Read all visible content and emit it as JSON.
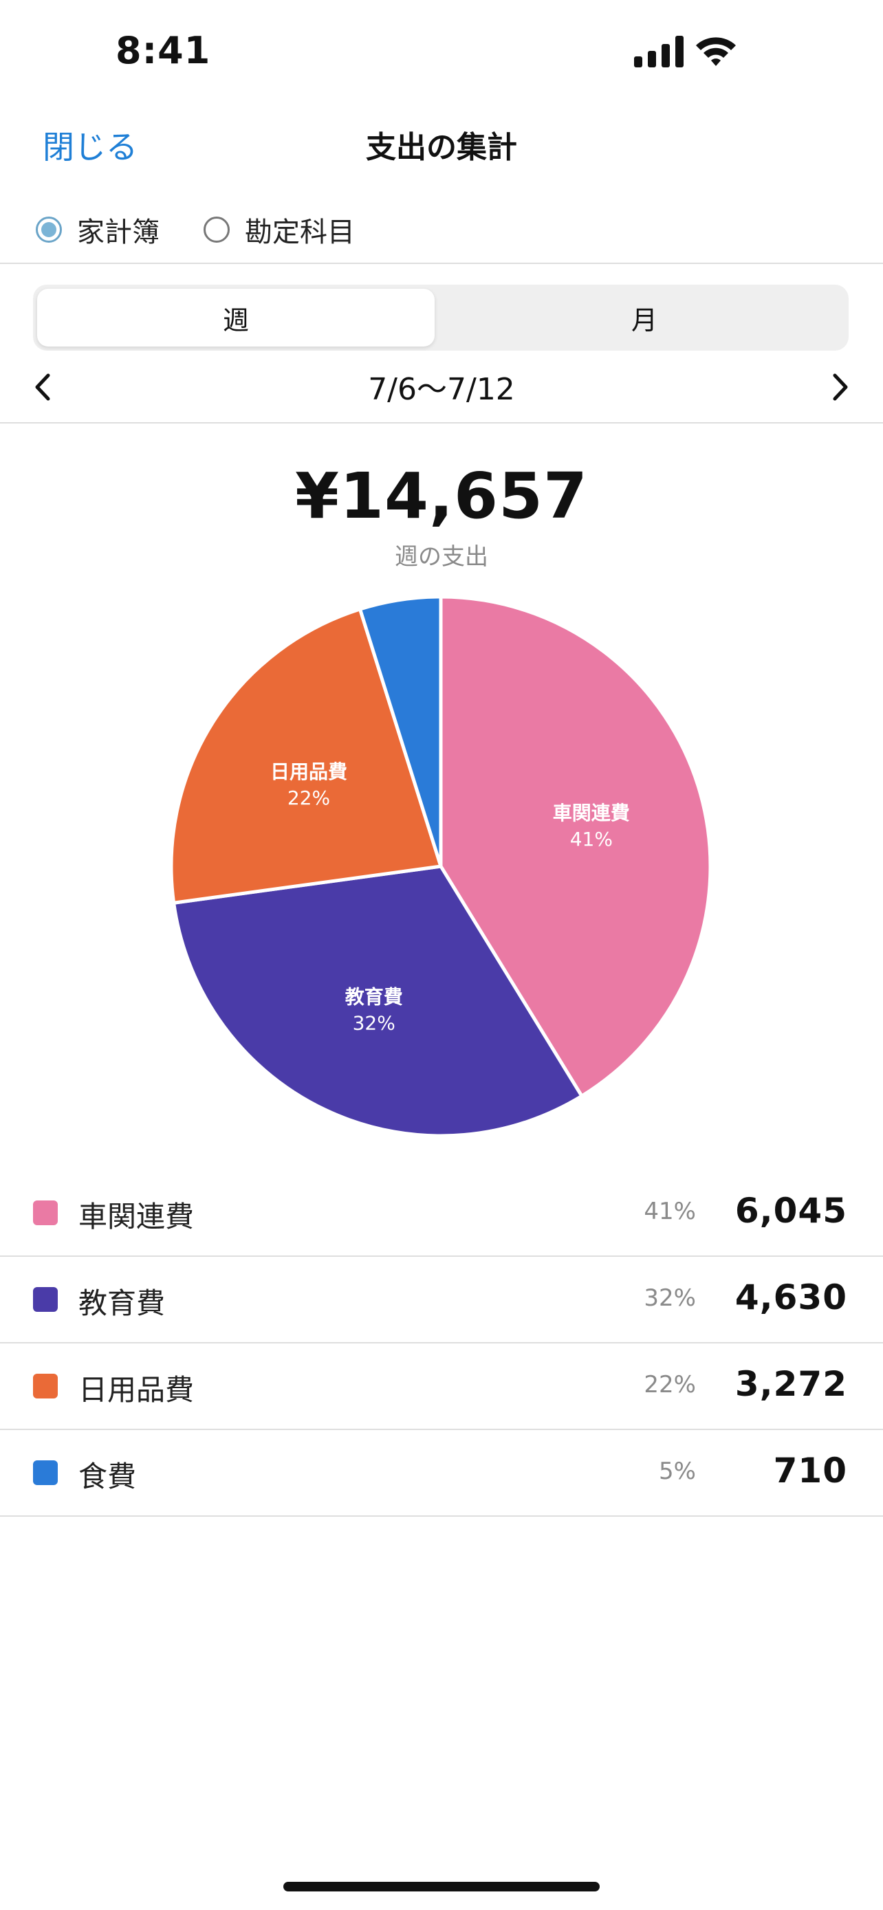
{
  "status_bar": {
    "time": "8:41",
    "signal_icon": "cellular-signal-icon",
    "wifi_icon": "wifi-icon"
  },
  "nav": {
    "close_label": "閉じる",
    "title": "支出の集計"
  },
  "radio": {
    "options": [
      {
        "label": "家計簿",
        "selected": true
      },
      {
        "label": "勘定科目",
        "selected": false
      }
    ]
  },
  "segmented": {
    "options": [
      "週",
      "月"
    ],
    "selected": "週"
  },
  "period": {
    "label": "7/6〜7/12",
    "prev_icon": "chevron-left-icon",
    "next_icon": "chevron-right-icon"
  },
  "summary": {
    "total": "¥14,657",
    "subtitle": "週の支出"
  },
  "chart_data": {
    "type": "pie",
    "slices": [
      {
        "label": "車関連費",
        "percent": 41,
        "percent_label": "41%",
        "value": 6045,
        "value_label": "6,045",
        "color": "#ea7aa4"
      },
      {
        "label": "教育費",
        "percent": 32,
        "percent_label": "32%",
        "value": 4630,
        "value_label": "4,630",
        "color": "#4a3ba8"
      },
      {
        "label": "日用品費",
        "percent": 22,
        "percent_label": "22%",
        "value": 3272,
        "value_label": "3,272",
        "color": "#ea6a37"
      },
      {
        "label": "食費",
        "percent": 5,
        "percent_label": "5%",
        "value": 710,
        "value_label": "710",
        "color": "#2a7bd8"
      }
    ],
    "total": 14657,
    "in_slice_labels": true,
    "legend": "below"
  },
  "legend_rows": [
    {
      "name": "車関連費",
      "pct": "41%",
      "value": "6,045",
      "color": "#ea7aa4"
    },
    {
      "name": "教育費",
      "pct": "32%",
      "value": "4,630",
      "color": "#4a3ba8"
    },
    {
      "name": "日用品費",
      "pct": "22%",
      "value": "3,272",
      "color": "#ea6a37"
    },
    {
      "name": "食費",
      "pct": "5%",
      "value": "710",
      "color": "#2a7bd8"
    }
  ]
}
